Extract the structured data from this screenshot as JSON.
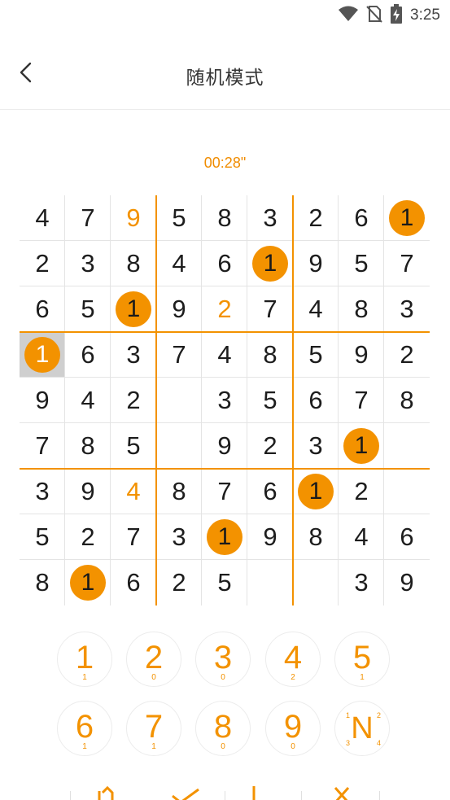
{
  "status_bar": {
    "time": "3:25",
    "icons": [
      "wifi-icon",
      "no-sim-icon",
      "battery-charging-icon"
    ]
  },
  "header": {
    "title": "随机模式",
    "back_icon": "chevron-left-icon"
  },
  "timer": "00:28\"",
  "colors": {
    "accent": "#f39200",
    "selected_cell": "#cfcfcf",
    "given_digit": "#1d1d1d"
  },
  "board": {
    "grid": [
      [
        "4",
        "7",
        "9",
        "5",
        "8",
        "3",
        "2",
        "6",
        "1"
      ],
      [
        "2",
        "3",
        "8",
        "4",
        "6",
        "1",
        "9",
        "5",
        "7"
      ],
      [
        "6",
        "5",
        "1",
        "9",
        "2",
        "7",
        "4",
        "8",
        "3"
      ],
      [
        "1",
        "6",
        "3",
        "7",
        "4",
        "8",
        "5",
        "9",
        "2"
      ],
      [
        "9",
        "4",
        "2",
        "",
        "3",
        "5",
        "6",
        "7",
        "8"
      ],
      [
        "7",
        "8",
        "5",
        "",
        "9",
        "2",
        "3",
        "1",
        ""
      ],
      [
        "3",
        "9",
        "4",
        "8",
        "7",
        "6",
        "1",
        "2",
        ""
      ],
      [
        "5",
        "2",
        "7",
        "3",
        "1",
        "9",
        "8",
        "4",
        "6"
      ],
      [
        "8",
        "1",
        "6",
        "2",
        "5",
        "",
        "",
        "3",
        "9"
      ]
    ],
    "user_entered": [
      [
        0,
        2
      ],
      [
        2,
        4
      ],
      [
        6,
        2
      ]
    ],
    "highlighted_digit": "1",
    "selected_cell": [
      3,
      0
    ]
  },
  "keypad": {
    "keys": [
      {
        "digit": "1",
        "count": "1"
      },
      {
        "digit": "2",
        "count": "0"
      },
      {
        "digit": "3",
        "count": "0"
      },
      {
        "digit": "4",
        "count": "2"
      },
      {
        "digit": "5",
        "count": "1"
      },
      {
        "digit": "6",
        "count": "1"
      },
      {
        "digit": "7",
        "count": "1"
      },
      {
        "digit": "8",
        "count": "0"
      },
      {
        "digit": "9",
        "count": "0"
      }
    ],
    "notes_key": {
      "label": "N",
      "corners": [
        "1",
        "2",
        "3",
        "4"
      ]
    }
  },
  "toolbar": {
    "tools": [
      "undo-icon",
      "check-icon",
      "pencil-icon",
      "erase-icon"
    ]
  }
}
